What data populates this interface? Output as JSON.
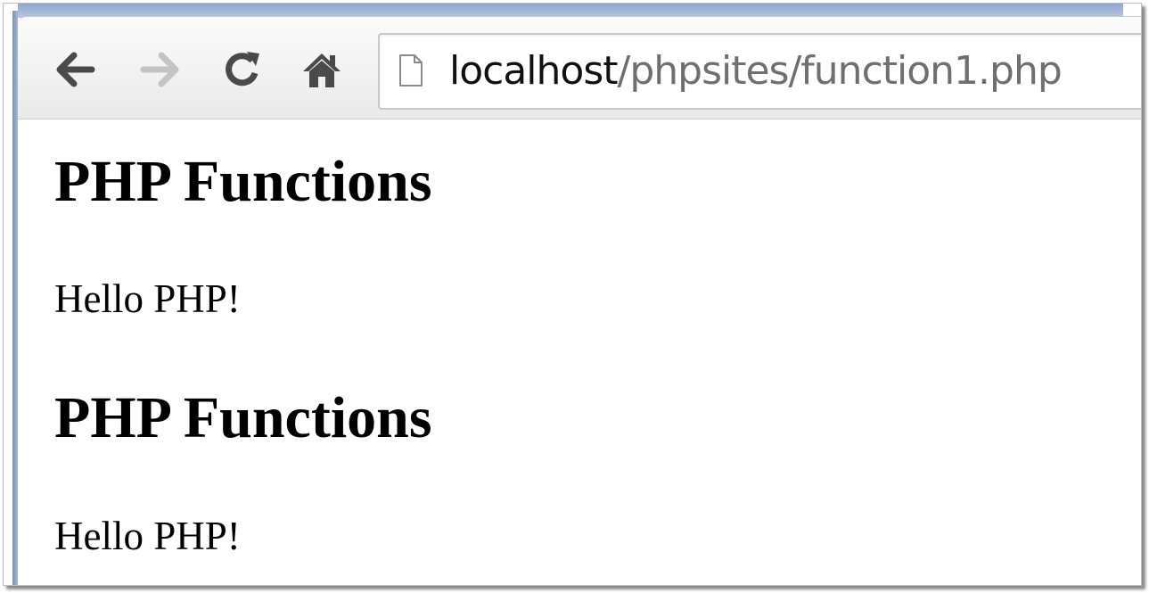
{
  "browser": {
    "address_bar": {
      "host": "localhost",
      "path": "/phpsites/function1.php"
    },
    "icons": {
      "back": "back-arrow-icon",
      "forward": "forward-arrow-icon",
      "reload": "reload-icon",
      "home": "home-icon",
      "page": "page-icon"
    }
  },
  "page": {
    "sections": [
      {
        "heading": "PHP Functions",
        "text": "Hello PHP!"
      },
      {
        "heading": "PHP Functions",
        "text": "Hello PHP!"
      }
    ]
  },
  "colors": {
    "window_frame": "#a8b8d6",
    "url_host": "#111111",
    "url_path": "#6f6f6f",
    "disabled_icon": "#c4c4c4",
    "active_icon": "#4a4a4a"
  }
}
